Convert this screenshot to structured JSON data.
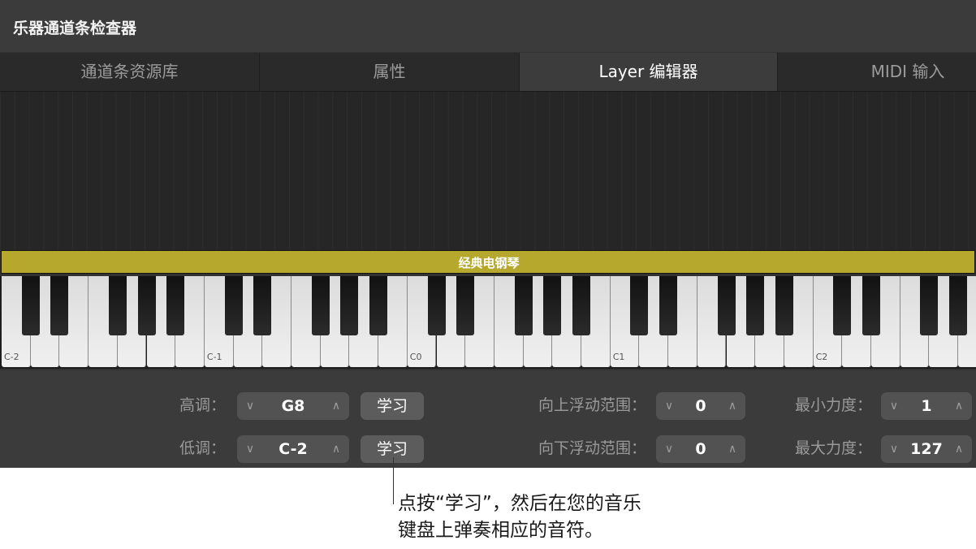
{
  "window": {
    "title": "乐器通道条检查器"
  },
  "tabs": [
    {
      "label": "通道条资源库",
      "active": false
    },
    {
      "label": "属性",
      "active": false
    },
    {
      "label": "Layer 编辑器",
      "active": true
    },
    {
      "label": "MIDI 输入",
      "active": false
    }
  ],
  "layer": {
    "name": "经典电钢琴",
    "color": "#b5a82c"
  },
  "keyboard": {
    "octave_labels": [
      "C-2",
      "C-1",
      "C0",
      "C1",
      "C2"
    ]
  },
  "controls": {
    "high_key": {
      "label": "高调：",
      "value": "G8",
      "learn": "学习"
    },
    "low_key": {
      "label": "低调：",
      "value": "C-2",
      "learn": "学习"
    },
    "float_up": {
      "label": "向上浮动范围：",
      "value": "0"
    },
    "float_down": {
      "label": "向下浮动范围：",
      "value": "0"
    },
    "min_velocity": {
      "label": "最小力度：",
      "value": "1"
    },
    "max_velocity": {
      "label": "最大力度：",
      "value": "127"
    }
  },
  "icons": {
    "decrement": "chevron-down-icon",
    "increment": "chevron-up-icon"
  },
  "callout": {
    "line1": "点按“学习”，然后在您的音乐",
    "line2": "键盘上弹奏相应的音符。"
  }
}
